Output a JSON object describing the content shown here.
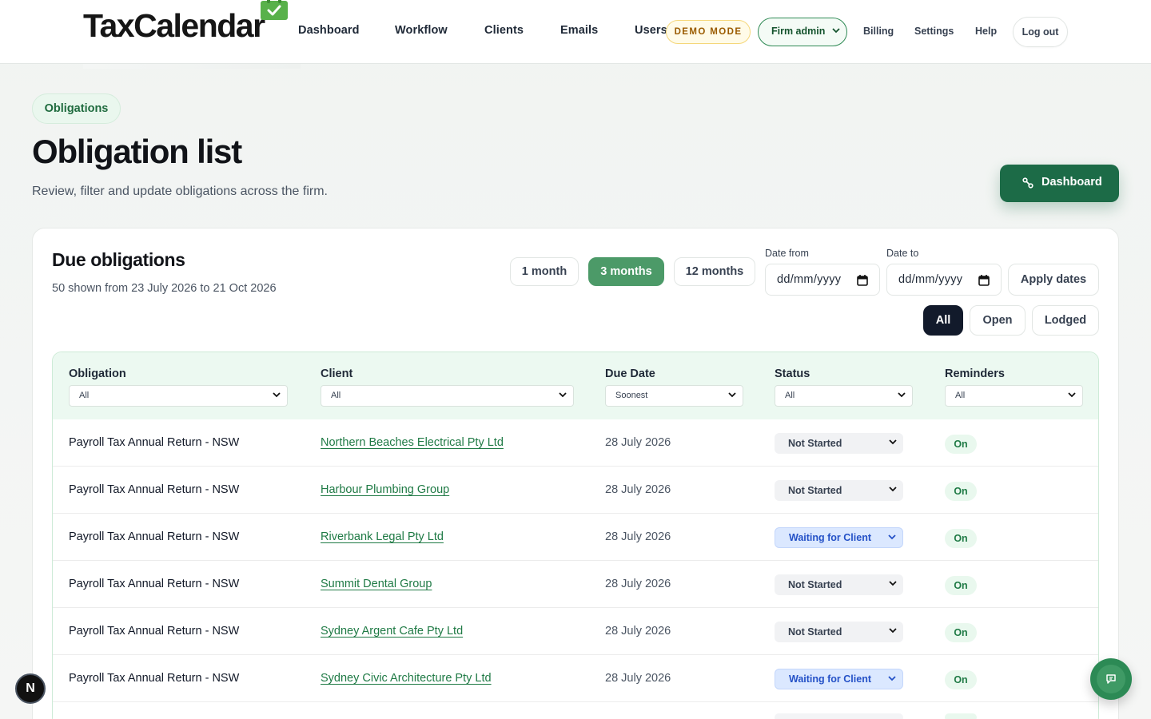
{
  "brand": {
    "name": "TaxCalendar"
  },
  "nav": {
    "links": [
      "Dashboard",
      "Workflow",
      "Clients",
      "Emails",
      "Users"
    ],
    "demo_badge": "DEMO MODE",
    "role": "Firm admin",
    "small_links": [
      "Billing",
      "Settings",
      "Help"
    ],
    "logout": "Log out"
  },
  "header": {
    "breadcrumb": "Obligations",
    "title": "Obligation list",
    "subtitle": "Review, filter and update obligations across the firm.",
    "dashboard_button": "Dashboard"
  },
  "card": {
    "title": "Due obligations",
    "subtitle": "50 shown from 23 July 2026 to 21 Oct 2026",
    "ranges": [
      {
        "label": "1 month",
        "active": false
      },
      {
        "label": "3 months",
        "active": true
      },
      {
        "label": "12 months",
        "active": false
      }
    ],
    "date_from": {
      "label": "Date from",
      "placeholder": "dd/mm/yyyy"
    },
    "date_to": {
      "label": "Date to",
      "placeholder": "dd/mm/yyyy"
    },
    "apply": "Apply dates",
    "filters": [
      {
        "label": "All",
        "active": true
      },
      {
        "label": "Open",
        "active": false
      },
      {
        "label": "Lodged",
        "active": false
      }
    ]
  },
  "table": {
    "columns": [
      {
        "label": "Obligation",
        "filter": "All"
      },
      {
        "label": "Client",
        "filter": "All"
      },
      {
        "label": "Due Date",
        "filter": "Soonest"
      },
      {
        "label": "Status",
        "filter": "All"
      },
      {
        "label": "Reminders",
        "filter": "All"
      }
    ],
    "rows": [
      {
        "obligation": "Payroll Tax Annual Return - NSW",
        "client": "Northern Beaches Electrical Pty Ltd",
        "due": "28 July 2026",
        "status": "Not Started",
        "reminders": "On"
      },
      {
        "obligation": "Payroll Tax Annual Return - NSW",
        "client": "Harbour Plumbing Group",
        "due": "28 July 2026",
        "status": "Not Started",
        "reminders": "On"
      },
      {
        "obligation": "Payroll Tax Annual Return - NSW",
        "client": "Riverbank Legal Pty Ltd",
        "due": "28 July 2026",
        "status": "Waiting for Client",
        "reminders": "On"
      },
      {
        "obligation": "Payroll Tax Annual Return - NSW",
        "client": "Summit Dental Group",
        "due": "28 July 2026",
        "status": "Not Started",
        "reminders": "On"
      },
      {
        "obligation": "Payroll Tax Annual Return - NSW",
        "client": "Sydney Argent Cafe Pty Ltd",
        "due": "28 July 2026",
        "status": "Not Started",
        "reminders": "On"
      },
      {
        "obligation": "Payroll Tax Annual Return - NSW",
        "client": "Sydney Civic Architecture Pty Ltd",
        "due": "28 July 2026",
        "status": "Waiting for Client",
        "reminders": "On"
      }
    ]
  },
  "floating": {
    "dev_badge": "N"
  },
  "colors": {
    "brand_green": "#1c6b47",
    "active_range": "#4c9a68",
    "active_filter": "#121a2b",
    "link_green": "#1f7a45",
    "waiting_blue": "#2451c7"
  }
}
